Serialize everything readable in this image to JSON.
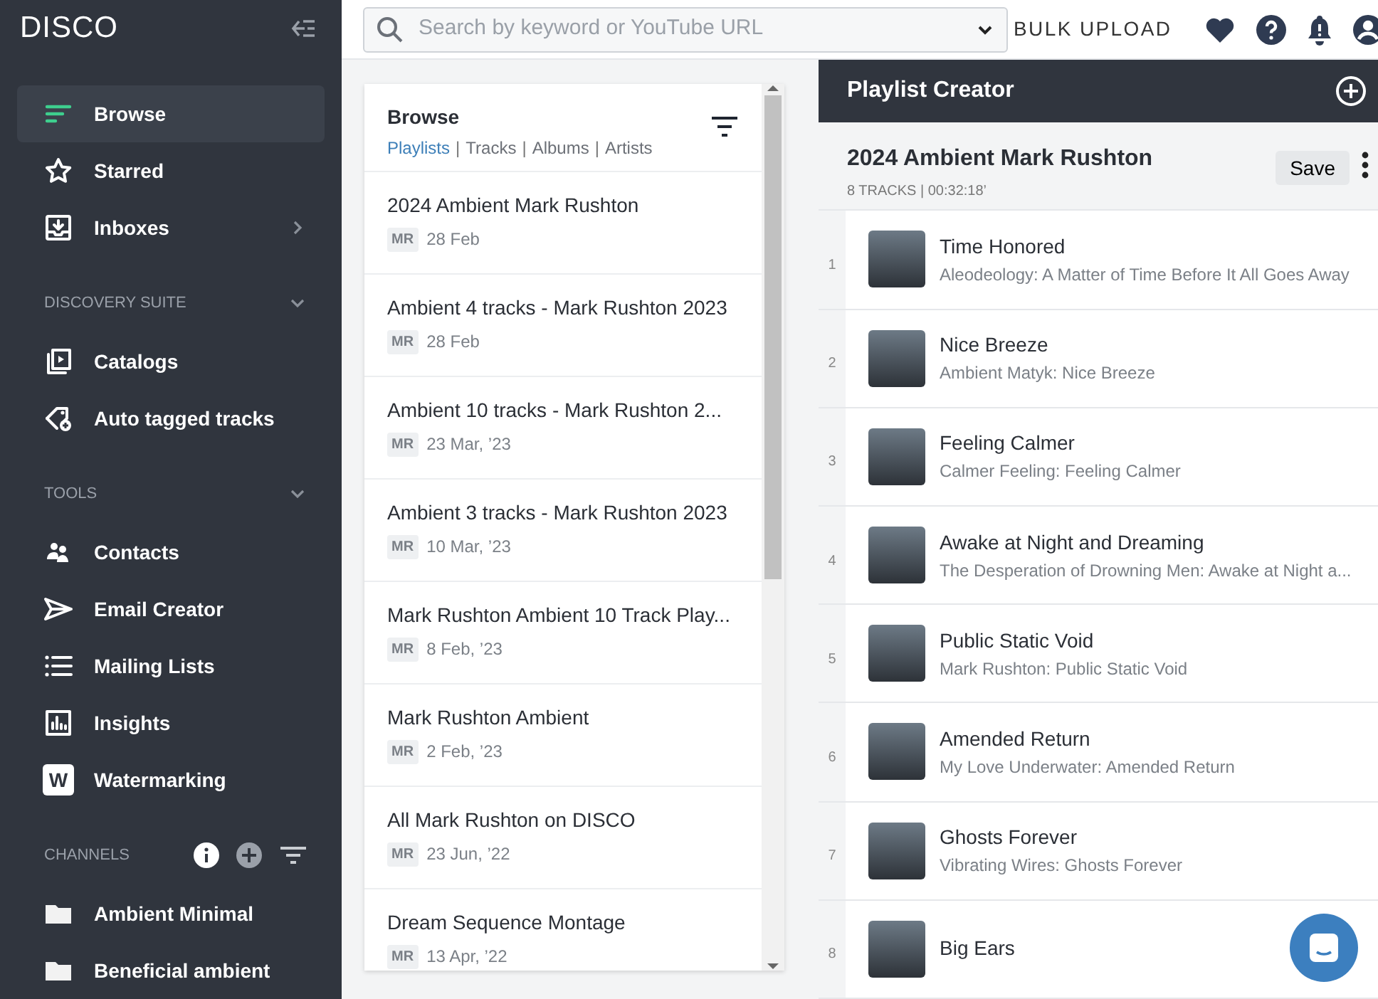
{
  "sidebar": {
    "logo": "DISCO",
    "items": [
      {
        "label": "Browse",
        "selected": true,
        "has_submenu": false
      },
      {
        "label": "Starred",
        "selected": false,
        "has_submenu": false
      },
      {
        "label": "Inboxes",
        "selected": false,
        "has_submenu": true
      }
    ],
    "sections": [
      {
        "title": "DISCOVERY SUITE",
        "expanded": true,
        "kind": "collapsible",
        "items": [
          {
            "label": "Catalogs"
          },
          {
            "label": "Auto tagged tracks"
          }
        ]
      },
      {
        "title": "TOOLS",
        "expanded": true,
        "kind": "collapsible",
        "items": [
          {
            "label": "Contacts"
          },
          {
            "label": "Email Creator"
          },
          {
            "label": "Mailing Lists"
          },
          {
            "label": "Insights"
          },
          {
            "label": "Watermarking",
            "badge": "W"
          }
        ]
      },
      {
        "title": "CHANNELS",
        "kind": "channels",
        "items": [
          {
            "label": "Ambient Minimal"
          },
          {
            "label": "Beneficial ambient"
          }
        ]
      }
    ]
  },
  "search": {
    "placeholder": "Search by keyword or YouTube URL"
  },
  "top_bar": {
    "bulk_upload": "BULK UPLOAD"
  },
  "browse": {
    "title": "Browse",
    "tabs": [
      {
        "label": "Playlists",
        "selected": true
      },
      {
        "label": "Tracks",
        "selected": false
      },
      {
        "label": "Albums",
        "selected": false
      },
      {
        "label": "Artists",
        "selected": false
      }
    ],
    "tab_separators": [
      "|",
      "|",
      "|"
    ],
    "playlists": [
      {
        "title": "2024 Ambient Mark Rushton",
        "owner": "MR",
        "date": "28 Feb"
      },
      {
        "title": "Ambient 4 tracks - Mark Rushton 2023",
        "owner": "MR",
        "date": "28 Feb"
      },
      {
        "title": "Ambient 10 tracks - Mark Rushton 2...",
        "owner": "MR",
        "date": "23 Mar, ’23"
      },
      {
        "title": "Ambient 3 tracks - Mark Rushton 2023",
        "owner": "MR",
        "date": "10 Mar, ’23"
      },
      {
        "title": "Mark Rushton Ambient 10 Track Play...",
        "owner": "MR",
        "date": "8 Feb, ’23"
      },
      {
        "title": "Mark Rushton Ambient",
        "owner": "MR",
        "date": "2 Feb, ’23"
      },
      {
        "title": "All Mark Rushton on DISCO",
        "owner": "MR",
        "date": "23 Jun, ’22"
      },
      {
        "title": "Dream Sequence Montage",
        "owner": "MR",
        "date": "13 Apr, ’22"
      }
    ]
  },
  "playlist_creator": {
    "title": "Playlist Creator",
    "playlist": {
      "title": "2024 Ambient Mark Rushton",
      "meta": "8 TRACKS | 00:32:18’",
      "save": "Save"
    },
    "tracks": [
      {
        "number": "1",
        "title": "Time Honored",
        "subtitle": "Aleodeology: A Matter of Time Before It All Goes Away"
      },
      {
        "number": "2",
        "title": "Nice Breeze",
        "subtitle": "Ambient Matyk: Nice Breeze"
      },
      {
        "number": "3",
        "title": "Feeling Calmer",
        "subtitle": "Calmer Feeling: Feeling Calmer"
      },
      {
        "number": "4",
        "title": "Awake at Night and Dreaming",
        "subtitle": "The Desperation of Drowning Men: Awake at Night a..."
      },
      {
        "number": "5",
        "title": "Public Static Void",
        "subtitle": "Mark Rushton: Public Static Void"
      },
      {
        "number": "6",
        "title": "Amended Return",
        "subtitle": "My Love Underwater: Amended Return"
      },
      {
        "number": "7",
        "title": "Ghosts Forever",
        "subtitle": "Vibrating Wires: Ghosts Forever"
      },
      {
        "number": "8",
        "title": "Big Ears"
      }
    ]
  }
}
